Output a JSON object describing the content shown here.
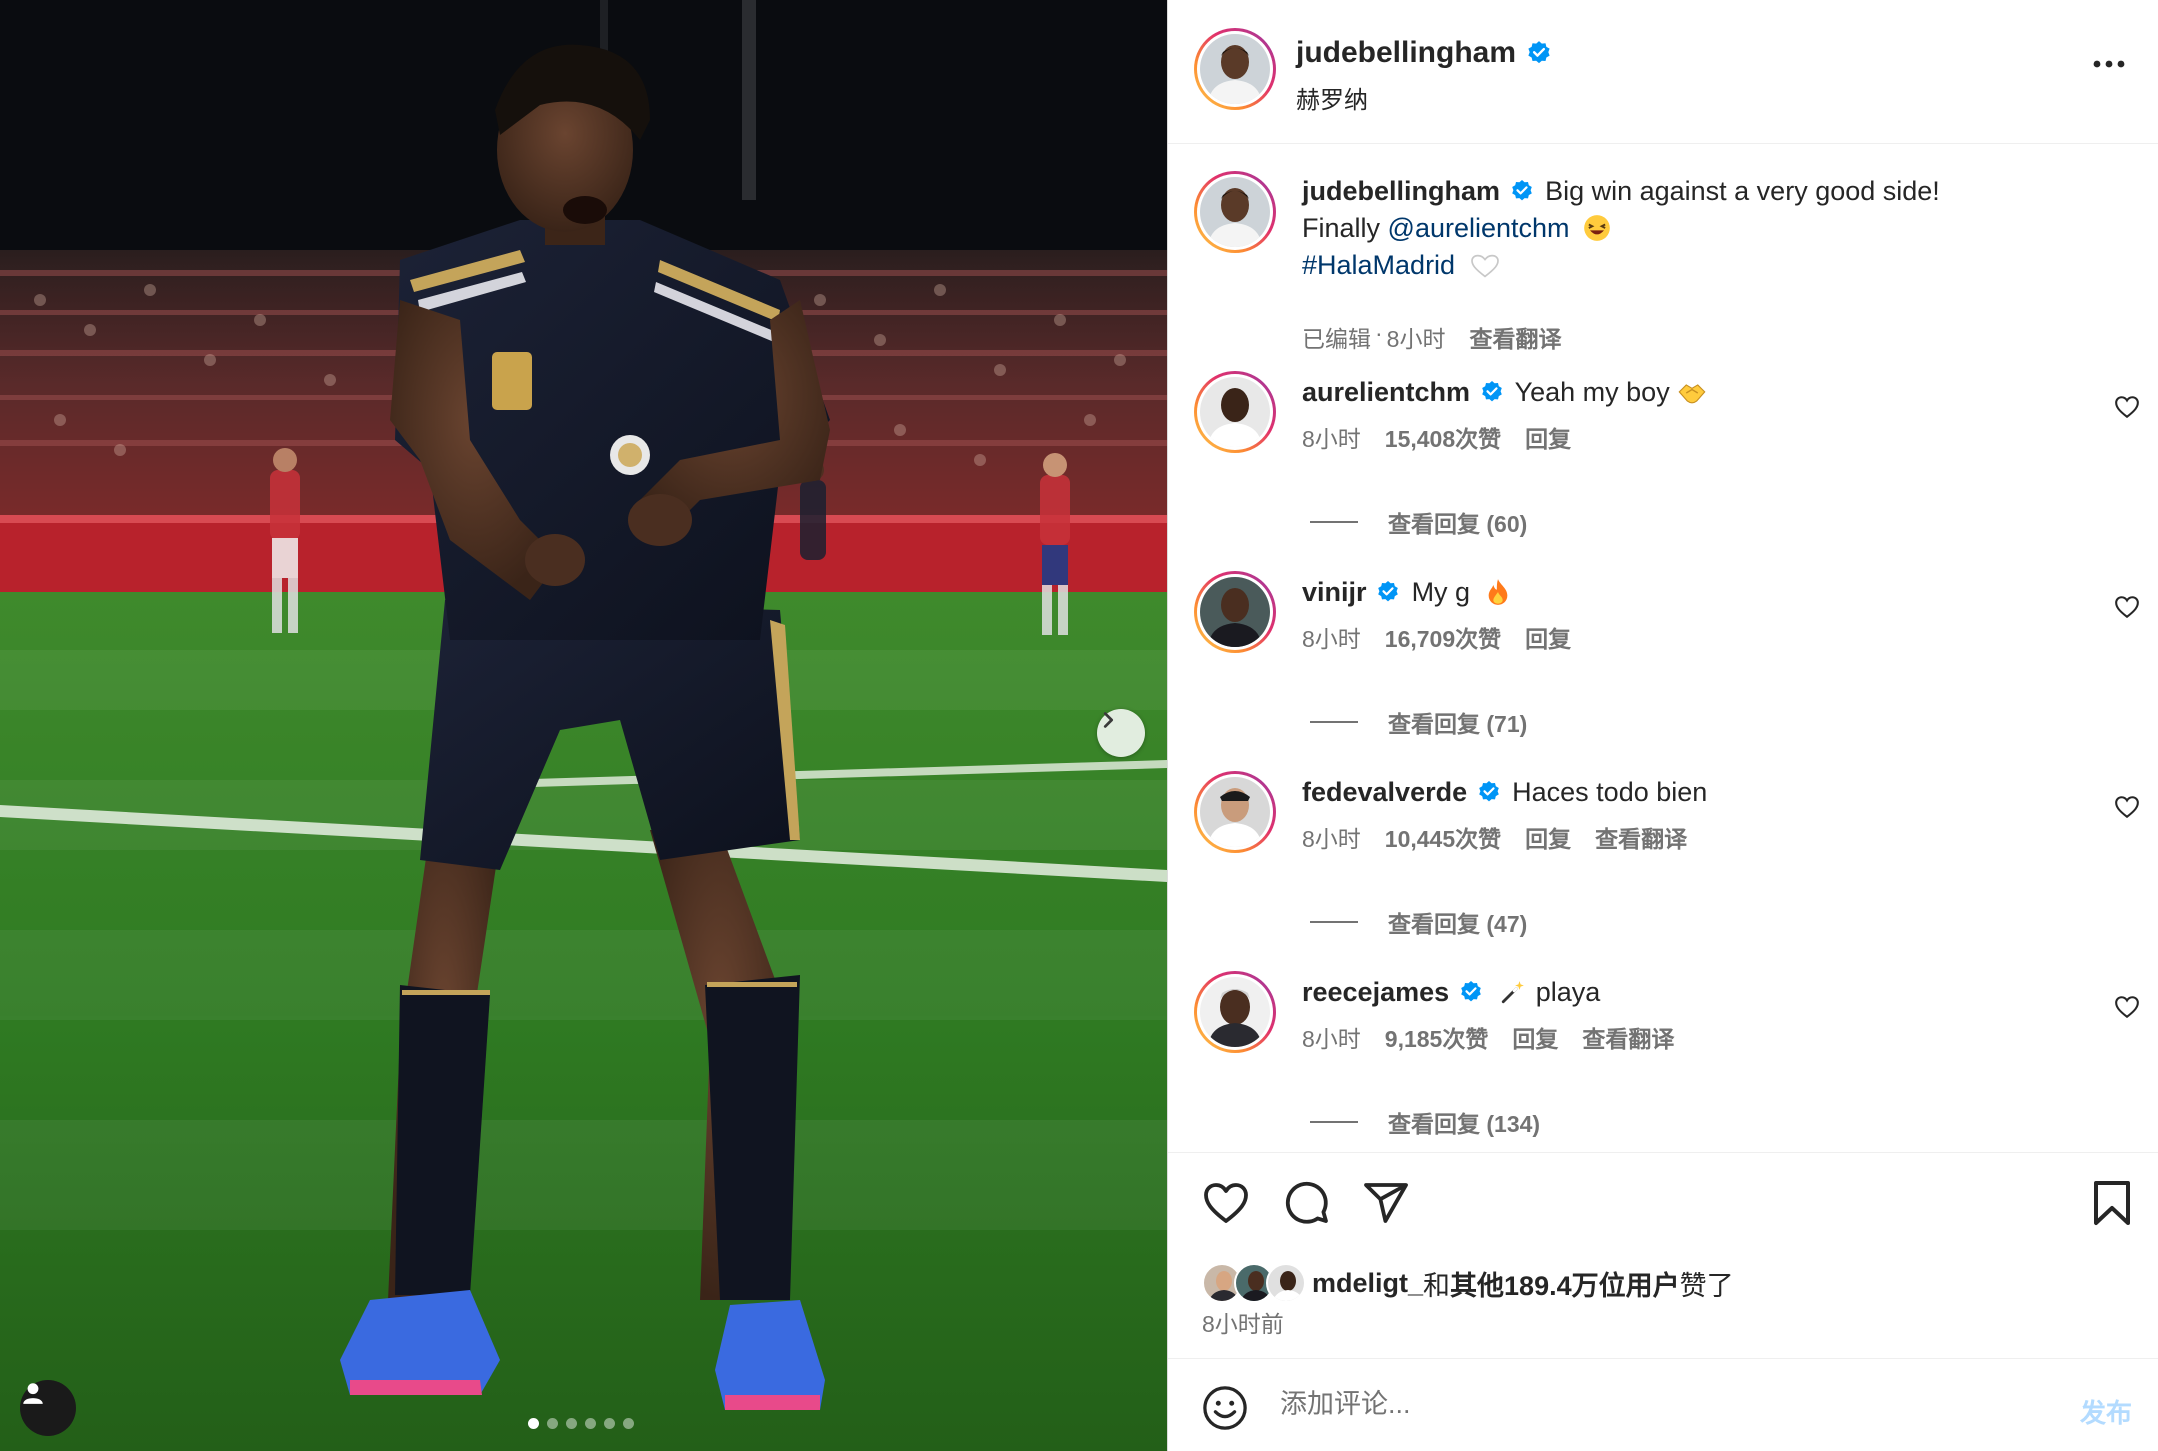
{
  "post": {
    "author": "judebellingham",
    "location": "赫罗纳",
    "caption": {
      "username": "judebellingham",
      "line1": "Big win against a very good side!",
      "line2_prefix": "Finally ",
      "mention": "@aurelientchm",
      "hashtag": "#HalaMadrid",
      "edited": "已编辑",
      "time": "8小时",
      "translate": "查看翻译"
    },
    "carousel": {
      "total": 6,
      "active": 1
    }
  },
  "comments": [
    {
      "username": "aurelientchm",
      "text": "Yeah my boy",
      "time": "8小时",
      "likes": "15,408次赞",
      "reply": "回复",
      "translate": "",
      "replies": "查看回复 (60)"
    },
    {
      "username": "vinijr",
      "text": "My g",
      "time": "8小时",
      "likes": "16,709次赞",
      "reply": "回复",
      "translate": "",
      "replies": "查看回复 (71)"
    },
    {
      "username": "fedevalverde",
      "text": "Haces todo bien",
      "time": "8小时",
      "likes": "10,445次赞",
      "reply": "回复",
      "translate": "查看翻译",
      "replies": "查看回复 (47)"
    },
    {
      "username": "reecejames",
      "text": "playa",
      "time": "8小时",
      "likes": "9,185次赞",
      "reply": "回复",
      "translate": "查看翻译",
      "replies": "查看回复 (134)"
    }
  ],
  "likes": {
    "user": "mdeligt_",
    "connector": "和",
    "others": "其他189.4万位用户",
    "suffix": "赞了",
    "time": "8小时前"
  },
  "composer": {
    "placeholder": "添加评论...",
    "post_label": "发布"
  },
  "colors": {
    "verified": "#0095f6",
    "link": "#00376b",
    "muted": "#737373",
    "post_disabled": "#b3dbff"
  },
  "icons": {
    "verified": "verified-badge-icon",
    "more": "more-horizontal-icon",
    "like": "heart-icon",
    "comment": "comment-icon",
    "share": "share-icon",
    "save": "bookmark-icon",
    "emoji": "emoji-icon",
    "next": "chevron-right-icon",
    "tag": "user-tag-icon"
  }
}
